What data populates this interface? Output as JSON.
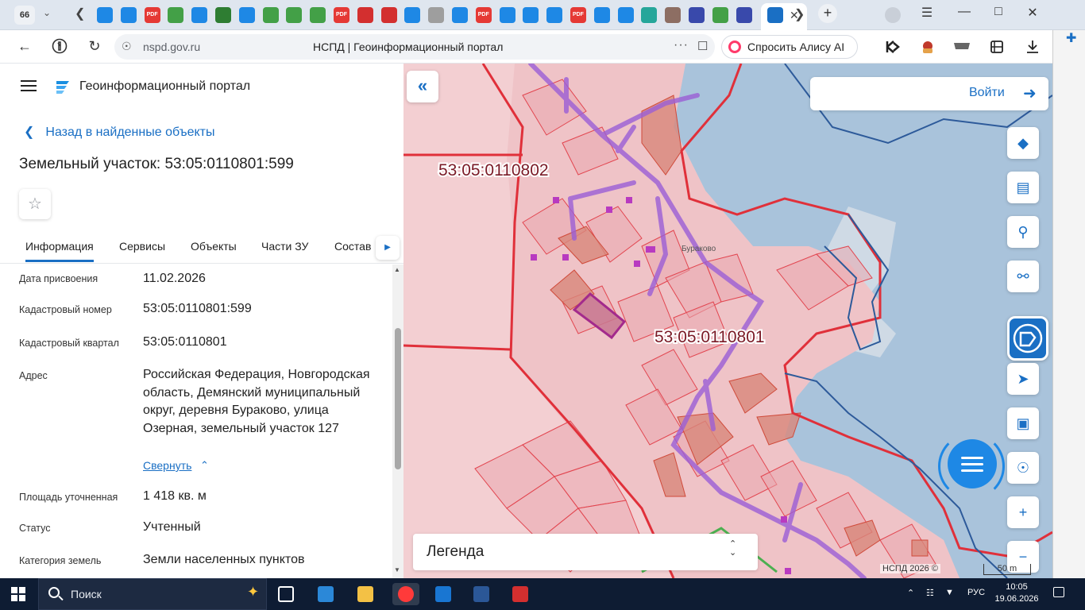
{
  "browser": {
    "tab_count": "66",
    "active_tab_favicon": "nspd-logo",
    "url": "nspd.gov.ru",
    "page_title": "НСПД | Геоинформационный портал",
    "alice_label": "Спросить Алису AI",
    "favicons": [
      {
        "icon": "image-icon",
        "color": "#1e88e5",
        "text": ""
      },
      {
        "icon": "mail-icon",
        "color": "#1e88e5",
        "text": ""
      },
      {
        "icon": "pdf-icon",
        "color": "#e53935",
        "text": "PDF"
      },
      {
        "icon": "check-icon",
        "color": "#43a047",
        "text": ""
      },
      {
        "icon": "doc-icon",
        "color": "#1e88e5",
        "text": ""
      },
      {
        "icon": "sheet-icon",
        "color": "#2e7d32",
        "text": ""
      },
      {
        "icon": "mail-icon",
        "color": "#1e88e5",
        "text": ""
      },
      {
        "icon": "check-icon",
        "color": "#43a047",
        "text": ""
      },
      {
        "icon": "check-icon",
        "color": "#43a047",
        "text": ""
      },
      {
        "icon": "check-icon",
        "color": "#43a047",
        "text": ""
      },
      {
        "icon": "pdf-icon",
        "color": "#e53935",
        "text": "PDF"
      },
      {
        "icon": "flag-icon",
        "color": "#d32f2f",
        "text": ""
      },
      {
        "icon": "flag-icon",
        "color": "#d32f2f",
        "text": ""
      },
      {
        "icon": "mail-icon",
        "color": "#1e88e5",
        "text": ""
      },
      {
        "icon": "emblem-icon",
        "color": "#9e9e9e",
        "text": ""
      },
      {
        "icon": "doc-icon",
        "color": "#1e88e5",
        "text": ""
      },
      {
        "icon": "pdf-icon",
        "color": "#e53935",
        "text": "PDF"
      },
      {
        "icon": "doc-icon",
        "color": "#1e88e5",
        "text": ""
      },
      {
        "icon": "doc-icon",
        "color": "#1e88e5",
        "text": ""
      },
      {
        "icon": "image-icon",
        "color": "#1e88e5",
        "text": ""
      },
      {
        "icon": "pdf-icon",
        "color": "#e53935",
        "text": "PDF"
      },
      {
        "icon": "doc-icon",
        "color": "#1e88e5",
        "text": ""
      },
      {
        "icon": "chat-icon",
        "color": "#1e88e5",
        "text": ""
      },
      {
        "icon": "star-icon",
        "color": "#26a69a",
        "text": ""
      },
      {
        "icon": "emblem-icon",
        "color": "#8d6e63",
        "text": ""
      },
      {
        "icon": "circle-icon",
        "color": "#3949ab",
        "text": ""
      },
      {
        "icon": "sheet-icon",
        "color": "#43a047",
        "text": ""
      },
      {
        "icon": "circle-icon",
        "color": "#3949ab",
        "text": ""
      }
    ]
  },
  "header": {
    "portal_title": "Геоинформационный портал"
  },
  "panel": {
    "back_label": "Назад в найденные объекты",
    "title": "Земельный участок: 53:05:0110801:599",
    "tabs": [
      {
        "label": "Информация"
      },
      {
        "label": "Сервисы"
      },
      {
        "label": "Объекты"
      },
      {
        "label": "Части ЗУ"
      },
      {
        "label": "Состав"
      }
    ],
    "fields": [
      {
        "label": "Дата присвоения",
        "value": "11.02.2026"
      },
      {
        "label": "Кадастровый номер",
        "value": "53:05:0110801:599"
      },
      {
        "label": "Кадастровый квартал",
        "value": "53:05:0110801"
      },
      {
        "label": "Адрес",
        "value": "Российская Федерация, Новгородская область, Демянский муниципальный округ, деревня Бураково, улица Озерная, земельный участок 127"
      },
      {
        "label": "Площадь уточненная",
        "value": "1 418 кв. м"
      },
      {
        "label": "Статус",
        "value": "Учтенный"
      },
      {
        "label": "Категория земель",
        "value": "Земли населенных пунктов"
      }
    ],
    "collapse_label": "Свернуть"
  },
  "map": {
    "login_label": "Войти",
    "legend_label": "Легенда",
    "copyright": "НСПД 2026 ©",
    "scale_label": "50 m",
    "labels": {
      "quarter_1": "53:05:0110802",
      "quarter_2": "53:05:0110801",
      "village": "Бураково"
    },
    "colors": {
      "water": "#a9c3db",
      "land": "#e8c8cc",
      "boundary": "#e0303a",
      "route": "#9b5fd6",
      "selected": "#a32a8c",
      "accent": "#1a6fc4"
    }
  },
  "taskbar": {
    "search_label": "Поиск",
    "language": "РУС",
    "time": "10:05",
    "date": "19.06.2026"
  }
}
